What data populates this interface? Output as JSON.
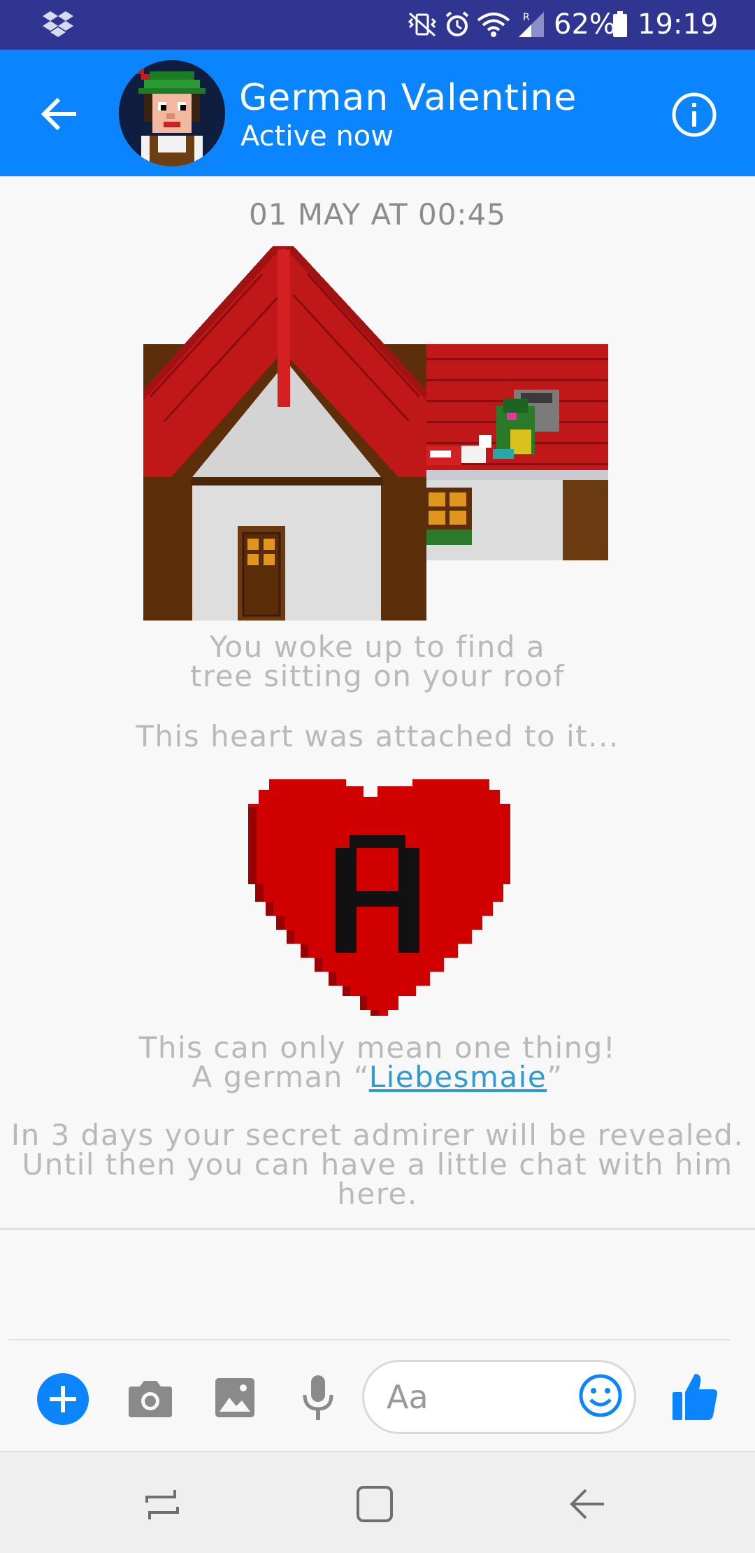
{
  "status_bar": {
    "battery_percent": "62%",
    "time": "19:19",
    "network_indicator": "R",
    "icons": [
      "dropbox-icon",
      "vibrate-icon",
      "alarm-icon",
      "wifi-icon",
      "signal-icon",
      "battery-icon"
    ]
  },
  "header": {
    "contact_name": "German Valentine",
    "presence": "Active now",
    "icons": [
      "back-arrow-icon",
      "info-icon"
    ]
  },
  "chat": {
    "timestamp": "01 MAY AT 00:45",
    "messages": [
      {
        "lines": [
          "You woke up to find a",
          "tree sitting on your roof"
        ]
      },
      {
        "lines": [
          "This heart was attached to it..."
        ]
      },
      {
        "prefix": "A german “",
        "link": "Liebesmaie",
        "suffix": "”",
        "first_line": "This can only mean one thing!"
      },
      {
        "lines": [
          "In 3 days your secret admirer will be revealed.",
          "Until then you can have a little chat with him",
          "here."
        ]
      }
    ],
    "heart_letter": "A"
  },
  "composer": {
    "placeholder": "Aa",
    "icons": [
      "plus-icon",
      "camera-icon",
      "image-icon",
      "microphone-icon",
      "emoji-icon",
      "thumbs-up-icon"
    ]
  },
  "nav_bar": {
    "icons": [
      "recent-apps-icon",
      "home-icon",
      "back-icon"
    ]
  },
  "colors": {
    "status_bar": "#303592",
    "header": "#0a84ff",
    "accent": "#0a84ff",
    "message_text": "#b9b9b9",
    "link": "#2e9bd3",
    "heart": "#d10000",
    "roof": "#b51313"
  }
}
